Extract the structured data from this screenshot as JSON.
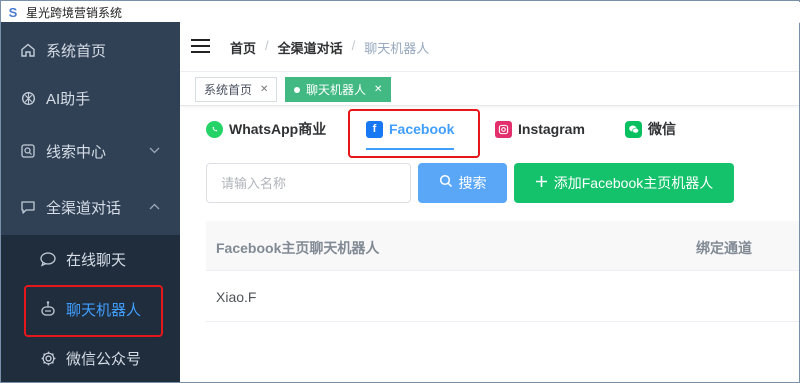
{
  "app": {
    "title": "星光跨境营销系统",
    "logo_glyph": "S"
  },
  "sidebar": {
    "items": [
      {
        "label": "系统首页",
        "icon": "home-icon"
      },
      {
        "label": "AI助手",
        "icon": "openai-icon"
      },
      {
        "label": "线索中心",
        "icon": "search-icon"
      },
      {
        "label": "全渠道对话",
        "icon": "chat-icon"
      }
    ],
    "submenu": [
      {
        "label": "在线聊天",
        "icon": "chat-bubble-icon"
      },
      {
        "label": "聊天机器人",
        "icon": "robot-icon"
      },
      {
        "label": "微信公众号",
        "icon": "gear-icon"
      }
    ]
  },
  "navbar": {
    "breadcrumbs": [
      "首页",
      "全渠道对话",
      "聊天机器人"
    ]
  },
  "tags": [
    {
      "label": "系统首页",
      "active": false
    },
    {
      "label": "聊天机器人",
      "active": true
    }
  ],
  "channels": [
    {
      "label": "WhatsApp商业",
      "icon": "whatsapp-icon",
      "color": "#25d366"
    },
    {
      "label": "Facebook",
      "icon": "facebook-icon",
      "color": "#1877f2"
    },
    {
      "label": "Instagram",
      "icon": "instagram-icon",
      "color": "#e1306c"
    },
    {
      "label": "微信",
      "icon": "wechat-icon",
      "color": "#07c160"
    }
  ],
  "search": {
    "placeholder": "请输入名称",
    "value": ""
  },
  "buttons": {
    "search_label": "搜索",
    "add_label": "添加Facebook主页机器人"
  },
  "table": {
    "columns": [
      "Facebook主页聊天机器人",
      "绑定通道"
    ],
    "rows": [
      [
        "Xiao.F",
        ""
      ]
    ]
  },
  "colors": {
    "sidebar_bg": "#304156",
    "submenu_bg": "#1f2d3d",
    "primary": "#409eff",
    "tag_active": "#42b983",
    "add_button": "#13c26b",
    "highlight_box": "#e5171b"
  }
}
